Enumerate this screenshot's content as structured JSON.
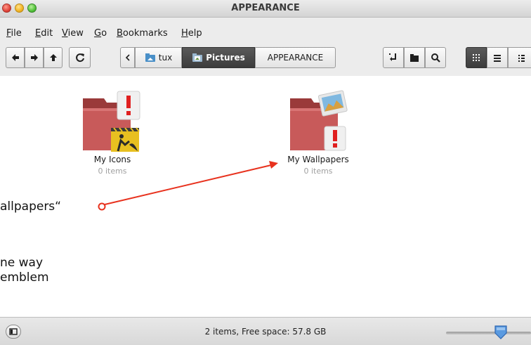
{
  "window": {
    "title": "APPEARANCE"
  },
  "menu": {
    "items": [
      {
        "label": "File"
      },
      {
        "label": "Edit"
      },
      {
        "label": "View"
      },
      {
        "label": "Go"
      },
      {
        "label": "Bookmarks"
      },
      {
        "label": "Help"
      }
    ]
  },
  "toolbar": {
    "breadcrumbs": [
      {
        "label": "tux"
      },
      {
        "label": "Pictures"
      },
      {
        "label": "APPEARANCE"
      }
    ]
  },
  "content": {
    "items": [
      {
        "name": "My Icons",
        "count": "0 items"
      },
      {
        "name": "My Wallpapers",
        "count": "0 items"
      }
    ]
  },
  "annotation": {
    "line1": "allpapers“",
    "line2": "ne way",
    "line3": "emblem",
    "color": "#e8321e"
  },
  "statusbar": {
    "text": "2 items, Free space: 57.8 GB"
  },
  "colors": {
    "folder": "#c85a5a",
    "emblem": "#e02020",
    "active_crumb": "#3c3c3c"
  }
}
